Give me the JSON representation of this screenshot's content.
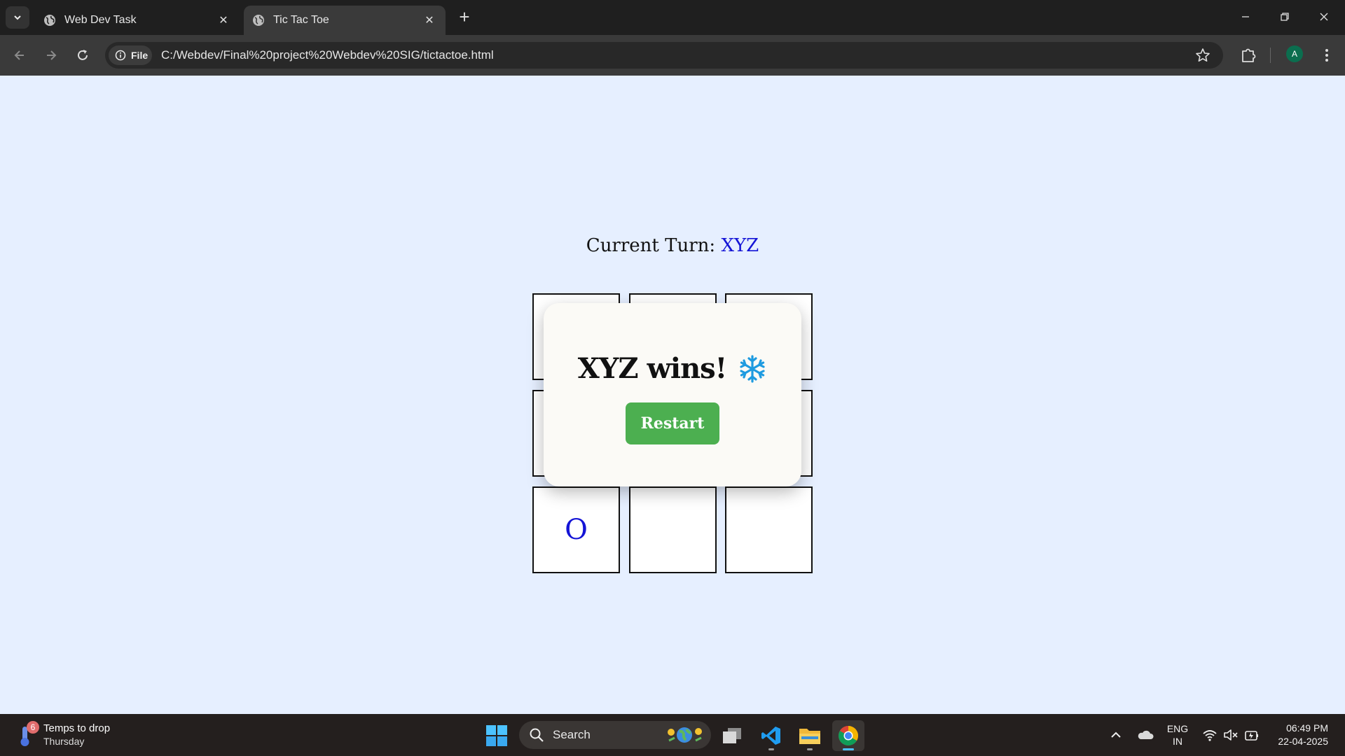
{
  "browser": {
    "tabs": [
      {
        "title": "Web Dev Task",
        "icon": "globe-icon",
        "active": false
      },
      {
        "title": "Tic Tac Toe",
        "icon": "globe-icon",
        "active": true
      }
    ],
    "site_chip_label": "File",
    "url": "C:/Webdev/Final%20project%20Webdev%20SIG/tictactoe.html",
    "profile_initial": "A"
  },
  "game": {
    "turn_label": "Current Turn:",
    "turn_player": "XYZ",
    "board": [
      "",
      "",
      "",
      "",
      "",
      "",
      "O",
      "",
      ""
    ],
    "player_color": "#1414d6",
    "modal": {
      "message": "XYZ wins!",
      "emoji_icon": "snowflake-icon",
      "restart_label": "Restart",
      "restart_color": "#4caf50"
    }
  },
  "taskbar": {
    "weather_badge": "6",
    "weather_line1": "Temps to drop",
    "weather_line2": "Thursday",
    "search_label": "Search",
    "lang_line1": "ENG",
    "lang_line2": "IN",
    "time": "06:49 PM",
    "date": "22-04-2025"
  }
}
